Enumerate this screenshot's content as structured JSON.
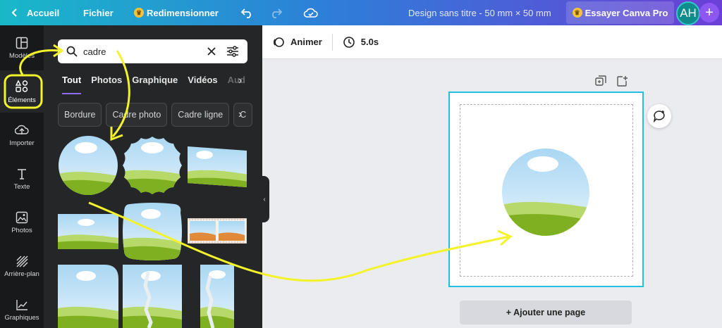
{
  "topbar": {
    "back_label": "Accueil",
    "file_label": "Fichier",
    "resize_label": "Redimensionner",
    "doc_title": "Design sans titre - 50 mm × 50 mm",
    "pro_label": "Essayer Canva Pro",
    "avatar_initials": "AH",
    "plus_symbol": "+"
  },
  "rail": [
    {
      "label": "Modèles",
      "icon": "template-icon"
    },
    {
      "label": "Éléments",
      "icon": "elements-icon"
    },
    {
      "label": "Importer",
      "icon": "upload-icon"
    },
    {
      "label": "Texte",
      "icon": "text-icon"
    },
    {
      "label": "Photos",
      "icon": "photo-icon"
    },
    {
      "label": "Arrière-plan",
      "icon": "background-icon"
    },
    {
      "label": "Graphiques",
      "icon": "chart-icon"
    }
  ],
  "panel": {
    "search_value": "cadre",
    "tabs": [
      "Tout",
      "Photos",
      "Graphique",
      "Vidéos",
      "Aud"
    ],
    "chips": [
      "Bordure",
      "Cadre photo",
      "Cadre ligne",
      "C"
    ]
  },
  "editor": {
    "animate_label": "Animer",
    "duration_label": "5.0s",
    "add_page_label": "+ Ajouter une page"
  },
  "colors": {
    "accent": "#8b6cf2",
    "selection": "#21c1e4",
    "annotation": "#f3f22b"
  }
}
